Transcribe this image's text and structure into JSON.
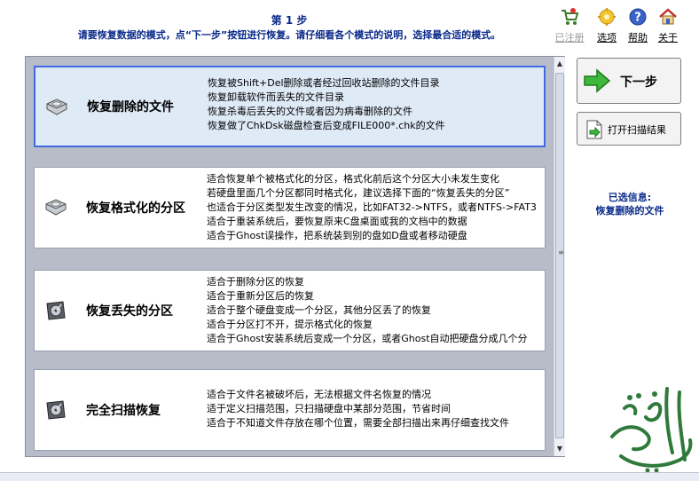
{
  "header": {
    "step": "第 1 步",
    "description": "请要恢复数据的模式，点“下一步”按钮进行恢复。请仔细看各个模式的说明，选择最合适的模式。"
  },
  "toolbar": {
    "register": "已注册",
    "options": "选项",
    "help": "帮助",
    "about": "关于"
  },
  "modes": [
    {
      "title": "恢复删除的文件",
      "lines": [
        "恢复被Shift+Del删除或者经过回收站删除的文件目录",
        "恢复卸载软件而丢失的文件目录",
        "恢复杀毒后丢失的文件或者因为病毒删除的文件",
        "恢复做了ChkDsk磁盘检查后变成FILE000*.chk的文件"
      ]
    },
    {
      "title": "恢复格式化的分区",
      "lines": [
        "适合恢复单个被格式化的分区，格式化前后这个分区大小未发生变化",
        "若硬盘里面几个分区都同时格式化，建议选择下面的“恢复丢失的分区”",
        "也适合于分区类型发生改变的情况，比如FAT32->NTFS，或者NTFS->FAT3",
        "适合于重装系统后，要恢复原来C盘桌面或我的文档中的数据",
        "适合于Ghost误操作，把系统装到别的盘如D盘或者移动硬盘"
      ]
    },
    {
      "title": "恢复丢失的分区",
      "lines": [
        "适合于删除分区的恢复",
        "适合于重新分区后的恢复",
        "适合于整个硬盘变成一个分区，其他分区丢了的恢复",
        "适合于分区打不开，提示格式化的恢复",
        "适合于Ghost安装系统后变成一个分区，或者Ghost自动把硬盘分成几个分"
      ]
    },
    {
      "title": "完全扫描恢复",
      "lines": [
        "适合于文件名被破坏后，无法根据文件名恢复的情况",
        "适于定义扫描范围，只扫描硬盘中某部分范围，节省时间",
        "适合于不知道文件存放在哪个位置，需要全部扫描出来再仔细查找文件"
      ]
    }
  ],
  "buttons": {
    "next": "下一步",
    "open_scan": "打开扫描结果"
  },
  "selected_info": {
    "label": "已选信息:",
    "value": "恢复删除的文件"
  },
  "colors": {
    "accent": "#4169e1",
    "title_blue": "#0a2a8a",
    "list_bg": "#b8bcc8",
    "selected_bg": "#dfeaf7"
  }
}
